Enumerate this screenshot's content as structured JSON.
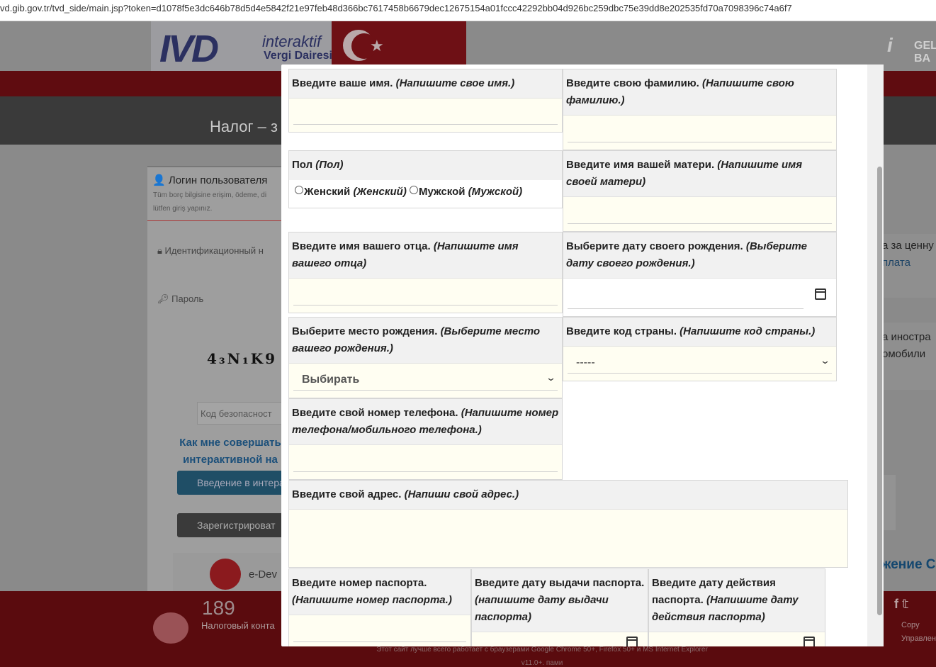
{
  "browser": {
    "url": "vd.gib.gov.tr/tvd_side/main.jsp?token=d1078f5e3dc646b78d5d4e5842f21e97feb48d366bc7617458b6679dec12675154a01fccc42292bb04d926bc259dbc75e39dd8e202535fd70a7098396c74a6f7"
  },
  "background": {
    "logo_main": "IVD",
    "logo_interaktif": "interaktif",
    "logo_vergi": "Vergi Dairesi",
    "gib_logo": "i",
    "gib_text": "GEL BA",
    "banner_title": "Налог – з",
    "login_title": "Логин пользователя",
    "login_sub": "Tüm borç bilgisine erişim, ödeme, di lütfen giriş yapınız.",
    "id_placeholder": "Идентификационный н",
    "password_placeholder": "Пароль",
    "captcha": "4₃N₁K9",
    "security_code_placeholder": "Код безопасност",
    "how_link": "Как мне совершать интерактивной на",
    "intro_button": "Введение в интера",
    "register_button": "Зарегистрироват",
    "edevlet": "e-Dev",
    "right_text1": "а за ценну",
    "right_text2": "плата",
    "right_text3": "а иностра",
    "right_text4": "омобили",
    "right_text5": "жение С",
    "footer_num": "189",
    "footer_label": "Налоговый конта",
    "footer_note": "Этот сайт лучше всего работает с браузерами Google Chrome 50+, Firefox 50+ и MS Internet Explorer v11.0+.",
    "footer_note_extra": "пами",
    "footer_copy": "Copy Управлен"
  },
  "form": {
    "first_name": {
      "label": "Введите ваше имя.",
      "hint": "(Напишите свое имя.)"
    },
    "last_name": {
      "label": "Введите свою фамилию.",
      "hint": "(Напишите свою фамилию.)"
    },
    "gender": {
      "label": "Пол",
      "hint": "(Пол)",
      "female": "Женский",
      "female_hint": "(Женский)",
      "male": "Мужской",
      "male_hint": "(Мужской)"
    },
    "mother_name": {
      "label": "Введите имя вашей матери.",
      "hint": "(Напишите имя своей матери)"
    },
    "father_name": {
      "label": "Введите имя вашего отца.",
      "hint": "(Напишите имя вашего отца)"
    },
    "birth_date": {
      "label": "Выберите дату своего рождения.",
      "hint": "(Выберите дату своего рождения.)"
    },
    "birth_place": {
      "label": "Выберите место рождения.",
      "hint": "(Выберите место вашего рождения.)",
      "selected": "Выбирать"
    },
    "country_code": {
      "label": "Введите код страны.",
      "hint": "(Напишите код страны.)",
      "selected": "-----"
    },
    "phone": {
      "label": "Введите свой номер телефона.",
      "hint": "(Напишите номер телефона/мобильного телефона.)"
    },
    "address": {
      "label": "Введите свой адрес.",
      "hint": "(Напиши свой адрес.)"
    },
    "passport_number": {
      "label": "Введите номер паспорта.",
      "hint": "(Напишите номер паспорта.)"
    },
    "passport_issue": {
      "label": "Введите дату выдачи паспорта.",
      "hint": "(напишите дату выдачи паспорта)"
    },
    "passport_expiry": {
      "label": "Введите дату действия паспорта.",
      "hint": "(Напишите дату действия паспорта)"
    }
  },
  "colors": {
    "input_bg": "#fffef2",
    "label_bg": "#f1f1f1",
    "footer": "#5a0b0e"
  }
}
